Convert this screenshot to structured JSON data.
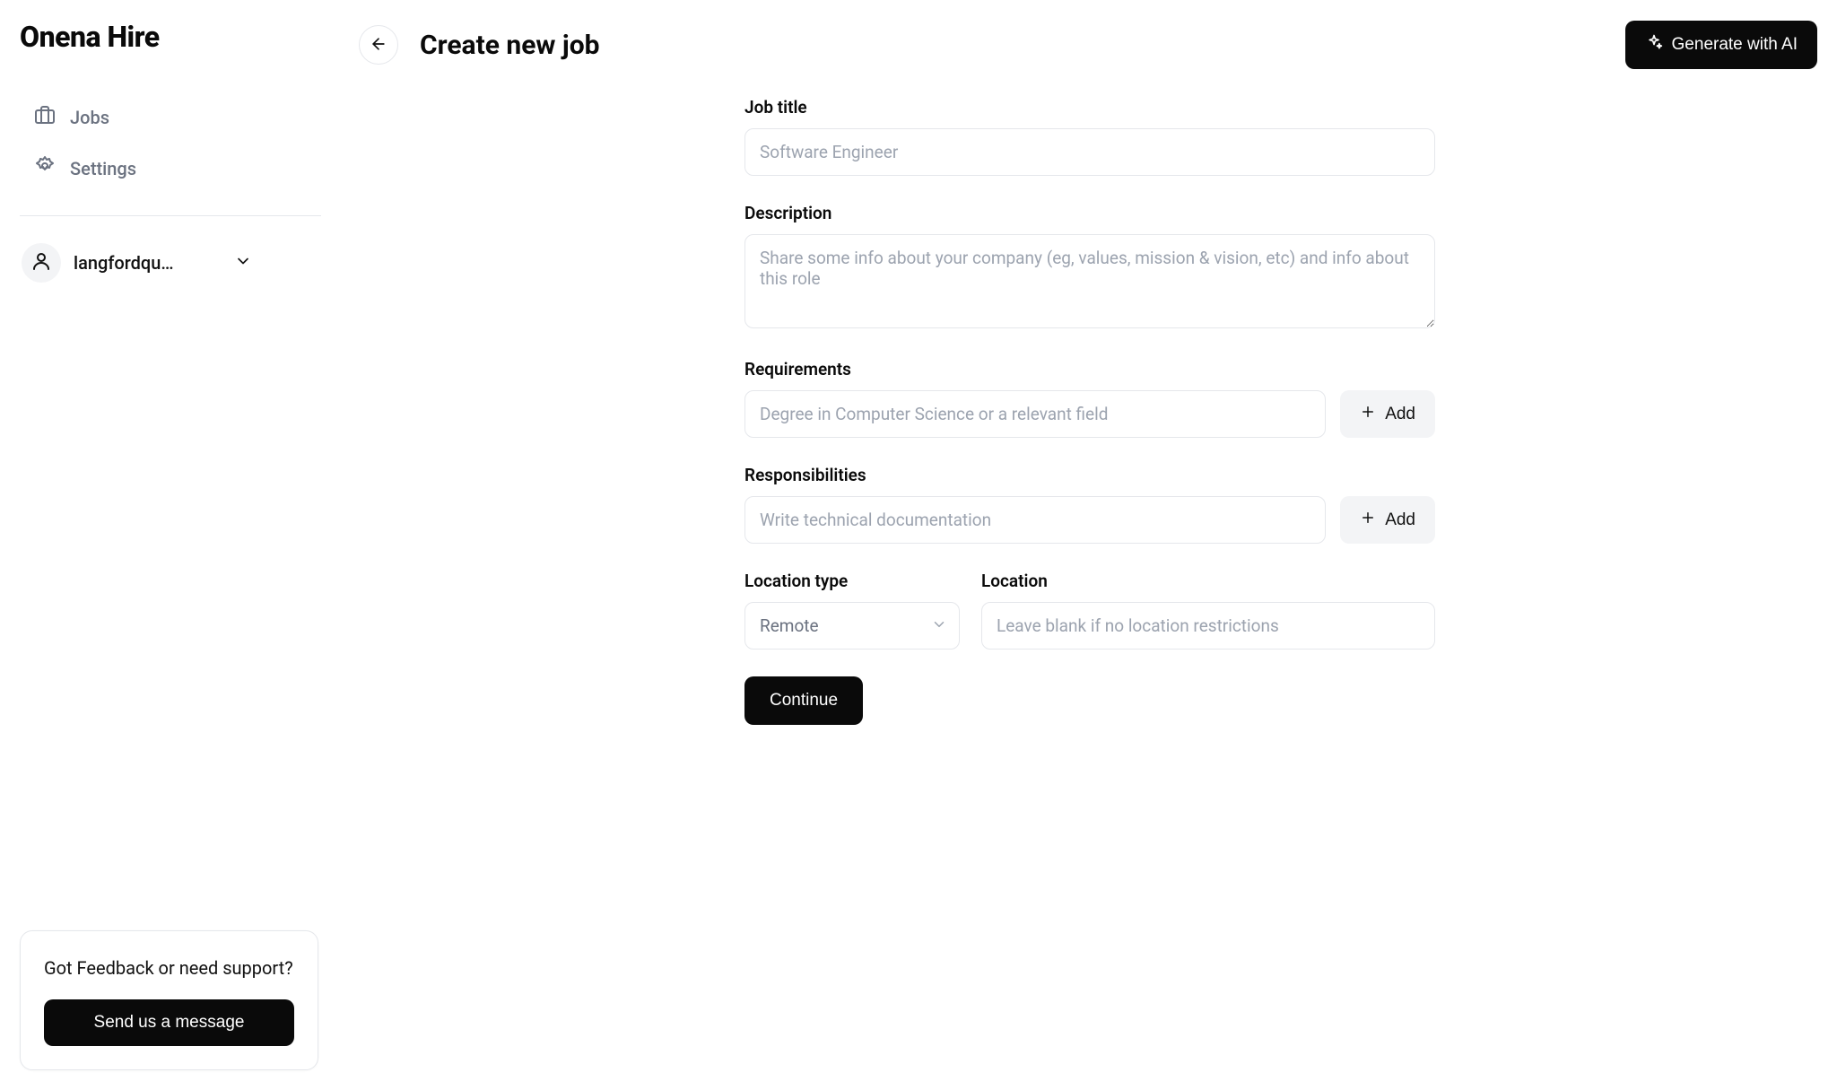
{
  "brand": "Onena Hire",
  "sidebar": {
    "items": [
      {
        "label": "Jobs"
      },
      {
        "label": "Settings"
      }
    ],
    "user": {
      "name": "langfordqu…"
    }
  },
  "header": {
    "title": "Create new job",
    "ai_button": "Generate with AI"
  },
  "form": {
    "job_title": {
      "label": "Job title",
      "placeholder": "Software Engineer",
      "value": ""
    },
    "description": {
      "label": "Description",
      "placeholder": "Share some info about your company (eg, values, mission & vision, etc) and info about this role",
      "value": ""
    },
    "requirements": {
      "label": "Requirements",
      "placeholder": "Degree in Computer Science or a relevant field",
      "value": "",
      "add_label": "Add"
    },
    "responsibilities": {
      "label": "Responsibilities",
      "placeholder": "Write technical documentation",
      "value": "",
      "add_label": "Add"
    },
    "location_type": {
      "label": "Location type",
      "selected": "Remote"
    },
    "location": {
      "label": "Location",
      "placeholder": "Leave blank if no location restrictions",
      "value": ""
    },
    "continue_label": "Continue"
  },
  "feedback": {
    "text": "Got Feedback or need support?",
    "button": "Send us a message"
  }
}
